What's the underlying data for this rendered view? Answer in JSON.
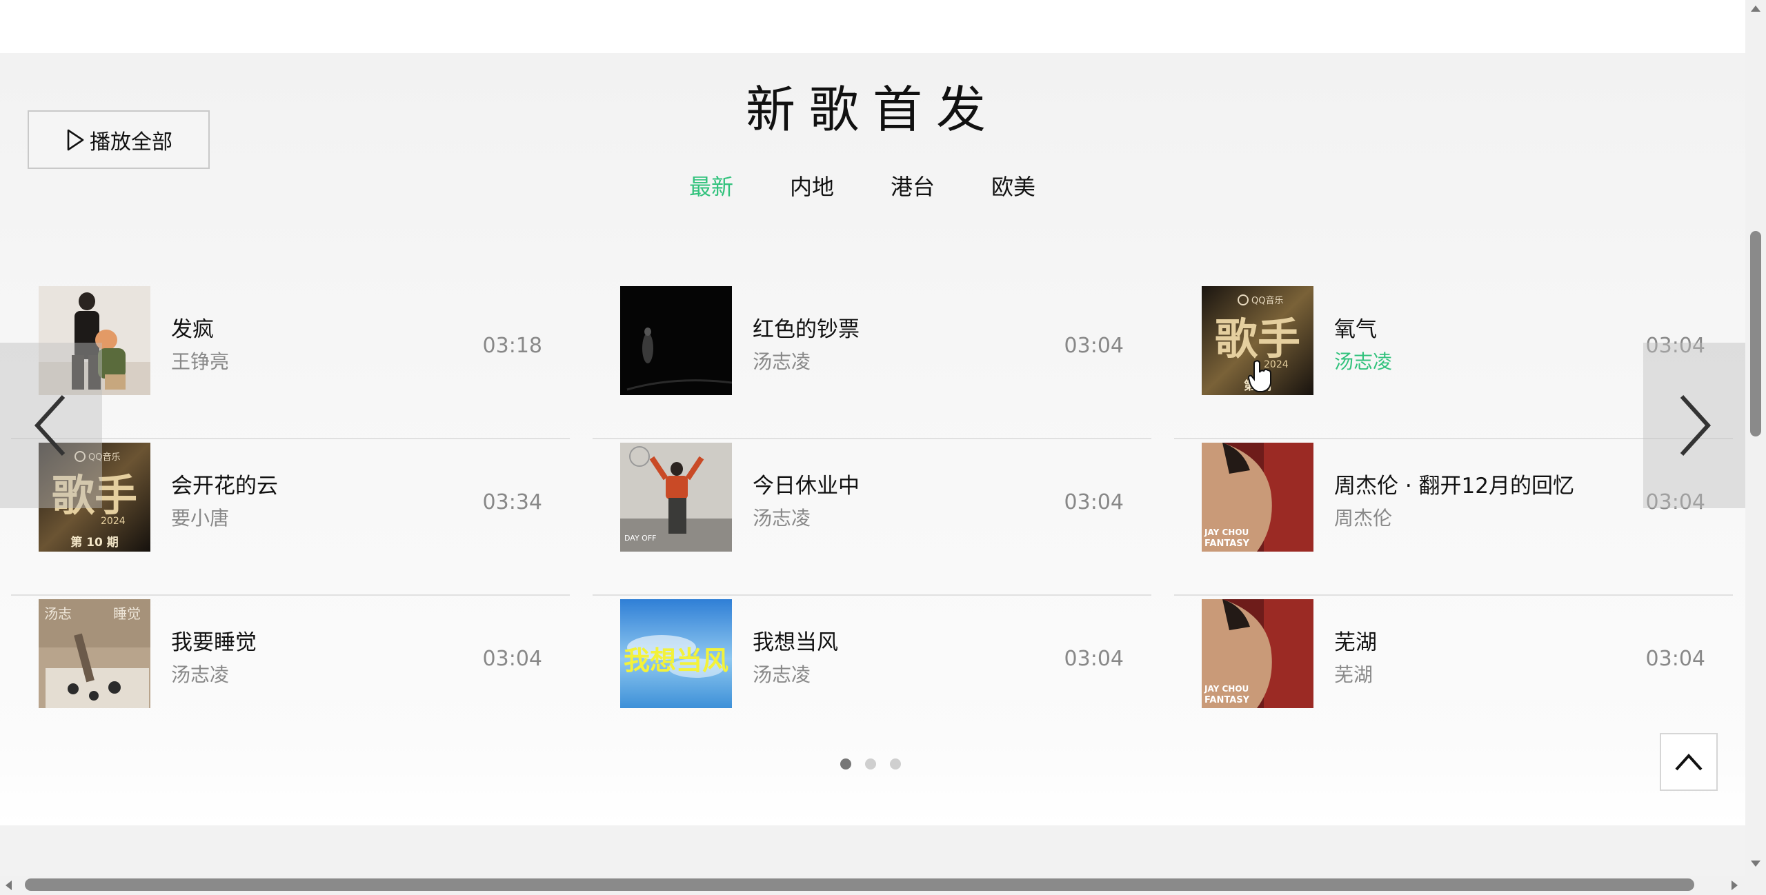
{
  "section": {
    "title": "新歌首发",
    "play_all_label": "播放全部"
  },
  "tabs": [
    {
      "label": "最新",
      "active": true
    },
    {
      "label": "内地",
      "active": false
    },
    {
      "label": "港台",
      "active": false
    },
    {
      "label": "欧美",
      "active": false
    }
  ],
  "songs": [
    {
      "name": "发疯",
      "singer": "王铮亮",
      "duration": "03:18"
    },
    {
      "name": "红色的钞票",
      "singer": "汤志凌",
      "duration": "03:04"
    },
    {
      "name": "氧气",
      "singer": "汤志凌",
      "duration": "03:04"
    },
    {
      "name": "会开花的云",
      "singer": "要小唐",
      "duration": "03:34"
    },
    {
      "name": "今日休业中",
      "singer": "汤志凌",
      "duration": "03:04"
    },
    {
      "name": "周杰伦 · 翻开12月的回忆",
      "singer": "周杰伦",
      "duration": "03:04"
    },
    {
      "name": "我要睡觉",
      "singer": "汤志凌",
      "duration": "03:04"
    },
    {
      "name": "我想当风",
      "singer": "汤志凌",
      "duration": "03:04"
    },
    {
      "name": "芜湖",
      "singer": "芜湖",
      "duration": "03:04"
    }
  ],
  "cover_text": {
    "qq_music": "QQ音乐",
    "singer_show": "歌手",
    "year": "2024",
    "episode_10": "第 10 期",
    "episode_partial": "第 期",
    "fantasy_artist": "JAY CHOU",
    "fantasy_title": "FANTASY",
    "sleep_a": "汤志",
    "sleep_b": "睡觉",
    "dayoff": "DAY OFF",
    "wind": "我想当风"
  },
  "carousel": {
    "pages": 3,
    "current": 1
  },
  "colors": {
    "accent": "#31c27c",
    "text": "#111111",
    "muted": "#888888"
  }
}
